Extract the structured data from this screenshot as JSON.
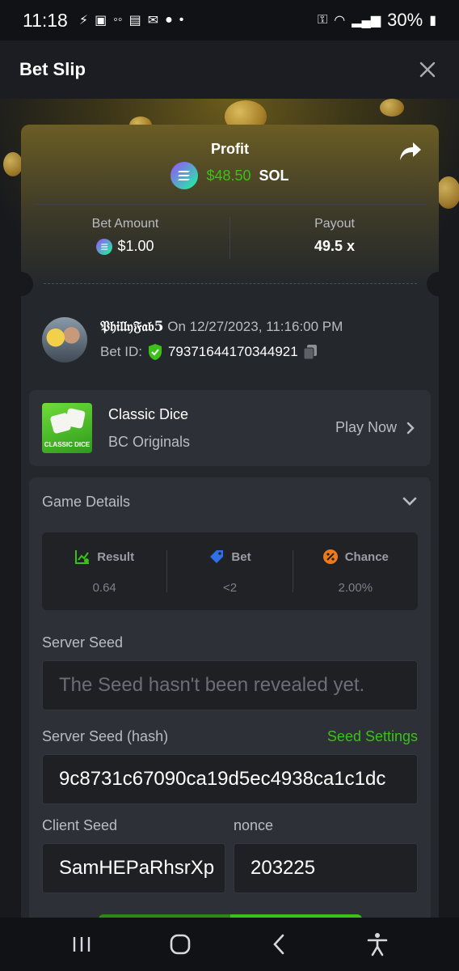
{
  "status_bar": {
    "time": "11:18",
    "battery": "30%"
  },
  "header": {
    "title": "Bet Slip"
  },
  "summary": {
    "profit_label": "Profit",
    "profit_amount": "$48.50",
    "profit_currency": "SOL",
    "bet_amount_label": "Bet Amount",
    "bet_amount_value": "$1.00",
    "payout_label": "Payout",
    "payout_value": "49.5 x"
  },
  "bet_info": {
    "username": "𝔓𝔥𝔦𝔩𝔩𝔶𝔉𝔞𝔟5",
    "date_text": "On 12/27/2023, 11:16:00 PM",
    "bet_id_label": "Bet ID:",
    "bet_id_value": "79371644170344921"
  },
  "game": {
    "name": "Classic Dice",
    "provider": "BC Originals",
    "thumb_label": "CLASSIC DICE",
    "play_label": "Play Now"
  },
  "details": {
    "title": "Game Details",
    "stats": [
      {
        "label": "Result",
        "value": "0.64",
        "icon": "result-chart-icon",
        "color": "#3bc117"
      },
      {
        "label": "Bet",
        "value": "<2",
        "icon": "bet-tag-icon",
        "color": "#2f6fe8"
      },
      {
        "label": "Chance",
        "value": "2.00%",
        "icon": "percent-icon",
        "color": "#f07a1a"
      }
    ],
    "server_seed_label": "Server Seed",
    "server_seed_value": "The Seed hasn't been revealed yet.",
    "server_seed_hash_label": "Server Seed (hash)",
    "seed_settings_label": "Seed Settings",
    "server_seed_hash_value": "9c8731c67090ca19d5ec4938ca1c1dc",
    "client_seed_label": "Client Seed",
    "client_seed_value": "SamHEPaRhsrXp",
    "nonce_label": "nonce",
    "nonce_value": "203225"
  },
  "colors": {
    "accent_green": "#3bc117",
    "background": "#17191d"
  }
}
